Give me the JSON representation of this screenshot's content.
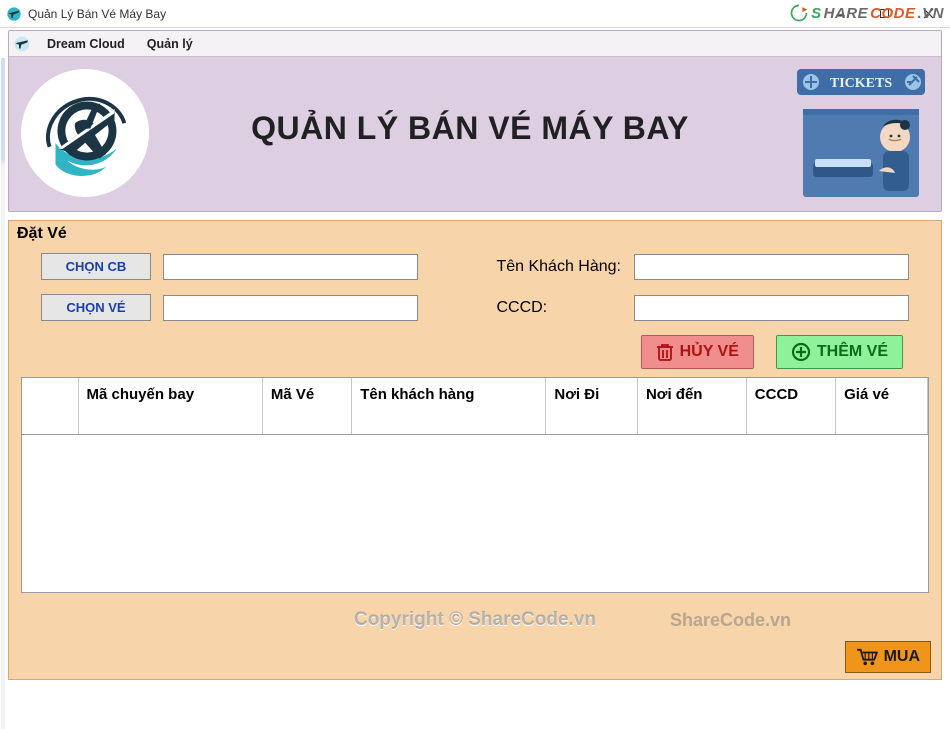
{
  "window": {
    "title": "Quản Lý Bán Vé Máy Bay"
  },
  "brand": {
    "s": "S",
    "hare": "HARE",
    "code": "CODE",
    "vn": ".VN"
  },
  "menu": {
    "dream_cloud": "Dream Cloud",
    "quan_ly": "Quản lý"
  },
  "banner": {
    "title": "QUẢN LÝ BÁN VÉ MÁY BAY",
    "tickets_label": "TICKETS"
  },
  "section": {
    "title": "Đặt Vé"
  },
  "buttons": {
    "chon_cb": "CHỌN CB",
    "chon_ve": "CHỌN VÉ",
    "huy_ve": "HỦY VÉ",
    "them_ve": "THÊM VÉ",
    "mua": "MUA"
  },
  "labels": {
    "ten_khach_hang": "Tên Khách Hàng:",
    "cccd": "CCCD:"
  },
  "fields": {
    "cb_value": "",
    "ve_value": "",
    "ten_value": "",
    "cccd_value": ""
  },
  "grid": {
    "headers": {
      "ma_chuyen_bay": "Mã chuyến bay",
      "ma_ve": "Mã Vé",
      "ten_khach_hang": "Tên khách hàng",
      "noi_di": "Nơi Đi",
      "noi_den": "Nơi đến",
      "cccd": "CCCD",
      "gia_ve": "Giá vé"
    },
    "rows": []
  },
  "watermark": {
    "center": "Copyright © ShareCode.vn",
    "right": "ShareCode.vn"
  }
}
